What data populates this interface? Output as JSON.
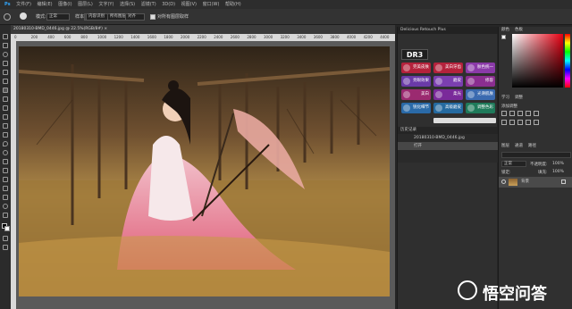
{
  "menu": [
    "文件(F)",
    "编辑(E)",
    "图像(I)",
    "图层(L)",
    "文字(Y)",
    "选择(S)",
    "滤镜(T)",
    "3D(D)",
    "视图(V)",
    "窗口(W)",
    "帮助(H)"
  ],
  "options": {
    "mode_label": "模式:",
    "mode_value": "正常",
    "opacity_label": "不透明度:",
    "opacity_value": "100%",
    "flow_label": "流量:",
    "flow_value": "100%",
    "sample_label": "样本:",
    "sample_value": "所有图层",
    "content_aware": "内容识别",
    "align_label": "对齐",
    "sample_all": "对所有图层取样"
  },
  "document": {
    "tab": "20180310-BMD_0446.jpg @ 22.5%(RGB/8#) ×"
  },
  "ruler_marks": [
    "0",
    "200",
    "400",
    "600",
    "800",
    "1000",
    "1200",
    "1400",
    "1600",
    "1800",
    "2000",
    "2200",
    "2400",
    "2600",
    "2800",
    "3000",
    "3200",
    "3400",
    "3600",
    "3800",
    "4000",
    "4200",
    "4400"
  ],
  "plugin": {
    "title": "Delicious Retouch Plus",
    "logo": "DR3",
    "buttons": [
      {
        "label": "完美皮肤",
        "color": "#b4223c"
      },
      {
        "label": "美白牙齿",
        "color": "#b4223c"
      },
      {
        "label": "肤色统一",
        "color": "#8a3aa8"
      },
      {
        "label": "亮眼效果",
        "color": "#6a3aa8"
      },
      {
        "label": "磨皮",
        "color": "#7b3fb0"
      },
      {
        "label": "修容",
        "color": "#8b2e90"
      },
      {
        "label": "美白",
        "color": "#9b2a70"
      },
      {
        "label": "柔光",
        "color": "#7a2a9a"
      },
      {
        "label": "光滑肌肤",
        "color": "#3a6ab0"
      },
      {
        "label": "锐化细节",
        "color": "#2a6aa8"
      },
      {
        "label": "高级磨皮",
        "color": "#256aa0"
      },
      {
        "label": "调整色彩",
        "color": "#1f7a5a"
      }
    ],
    "history_tab": "历史记录",
    "history_file": "20180310-BMD_0446.jpg",
    "history_step": "打开"
  },
  "right": {
    "color_tab": "颜色",
    "swatches_tab": "色板",
    "learn_tab": "学习",
    "adjust_tab": "调整",
    "adjust_label": "添加调整",
    "layers_tab": "图层",
    "channels_tab": "通道",
    "paths_tab": "路径",
    "blend_mode": "正常",
    "opacity_label": "不透明度:",
    "opacity_value": "100%",
    "lock_label": "锁定:",
    "fill_label": "填充:",
    "fill_value": "100%",
    "layer_name": "背景"
  },
  "watermark": {
    "text": "悟空问答"
  }
}
